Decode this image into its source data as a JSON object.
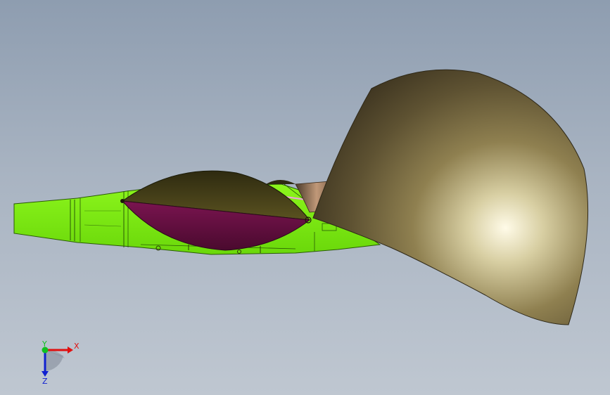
{
  "viewport": {
    "background_top": "#8e9db0",
    "background_bottom": "#bfc7d1"
  },
  "model": {
    "body_color": "#7ef010",
    "canopy_color": "#5c0d3a",
    "shell_color": "#8f8050"
  },
  "triad": {
    "x_label": "X",
    "y_label": "Y",
    "z_label": "Z",
    "x_color": "#e01010",
    "y_color": "#10c020",
    "z_color": "#1020d0"
  }
}
